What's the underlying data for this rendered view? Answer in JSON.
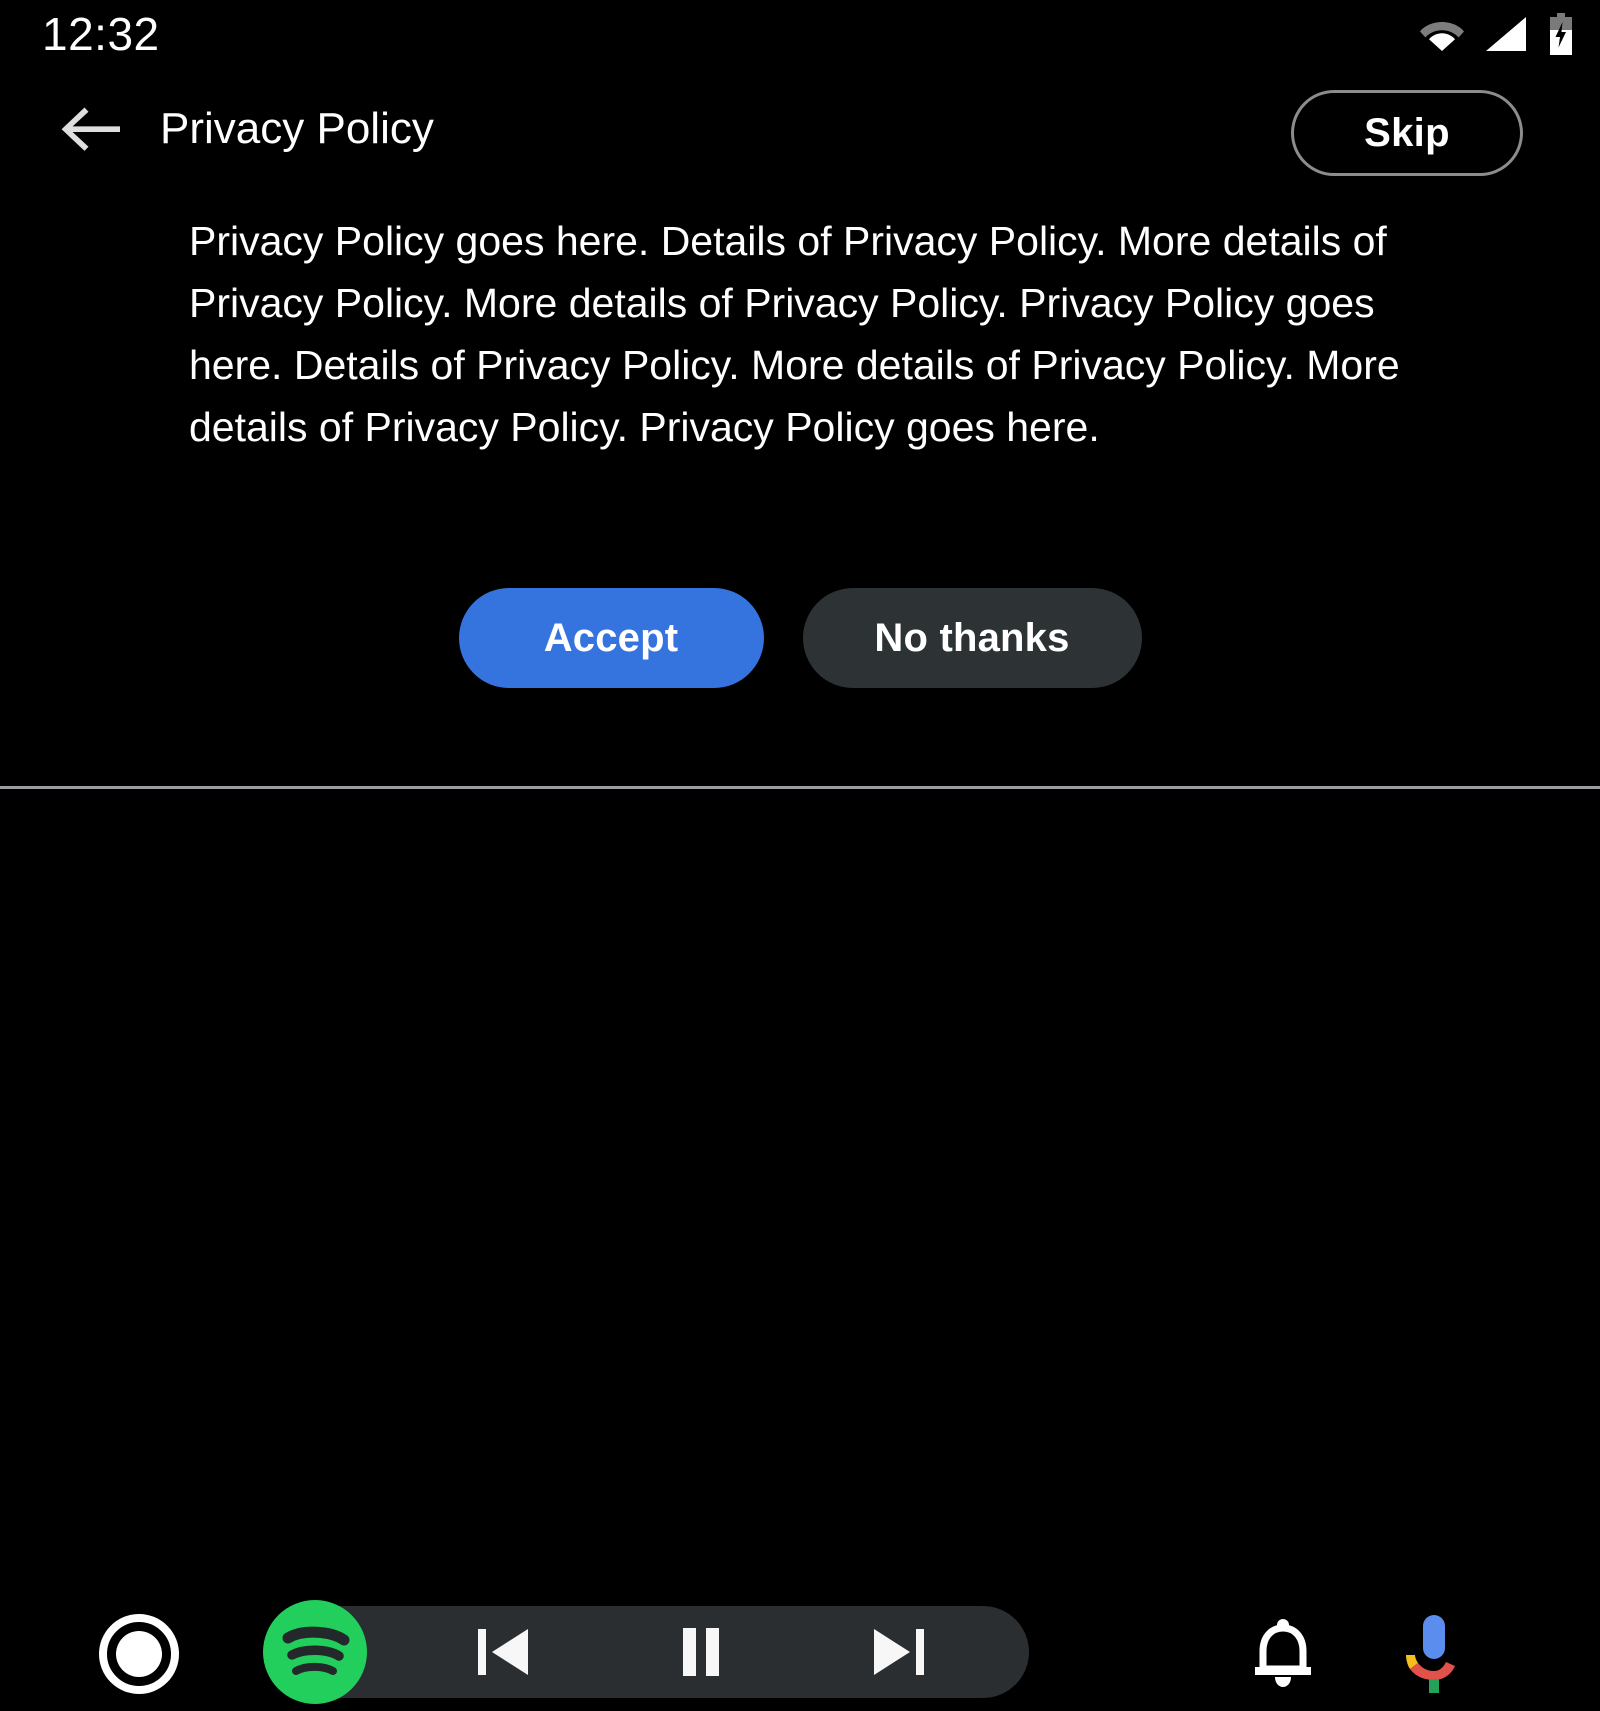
{
  "status_bar": {
    "clock": "12:32",
    "icons": [
      {
        "name": "wifi-icon",
        "label": "Wi-Fi"
      },
      {
        "name": "cellular-signal-icon",
        "label": "Cellular signal"
      },
      {
        "name": "battery-charging-icon",
        "label": "Battery charging"
      }
    ]
  },
  "header": {
    "back_icon": "arrow-left-icon",
    "title": "Privacy Policy",
    "skip_label": "Skip"
  },
  "content": {
    "policy_text": "Privacy Policy goes here. Details of Privacy Policy. More details of Privacy Policy. More details of Privacy Policy. Privacy Policy goes here. Details of Privacy Policy. More details of Privacy Policy. More details of Privacy Policy. Privacy Policy goes here.",
    "accept_label": "Accept",
    "no_thanks_label": "No thanks"
  },
  "nav_bar": {
    "home_icon": "home-circle-icon",
    "media": {
      "app_icon": "spotify-icon",
      "previous_icon": "skip-previous-icon",
      "pause_icon": "pause-icon",
      "next_icon": "skip-next-icon"
    },
    "notification_icon": "bell-icon",
    "assistant_icon": "google-assistant-mic-icon"
  },
  "colors": {
    "background": "#000000",
    "accept_blue": "#3573de",
    "no_thanks_gray": "#2d3235",
    "media_pill_gray": "#2b2e31",
    "spotify_green": "#22ce5c",
    "divider_gray": "#999da0",
    "skip_border_gray": "#8c8c8c",
    "text_white": "#ffffff"
  }
}
